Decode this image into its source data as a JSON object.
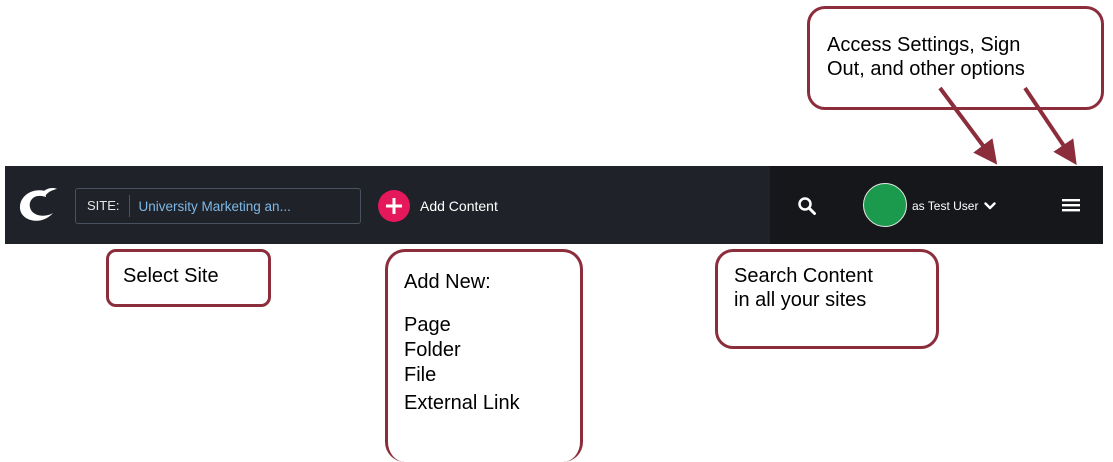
{
  "toolbar": {
    "site_label": "SITE:",
    "site_name": "University Marketing an...",
    "add_content_label": "Add Content",
    "user_label": "as Test User"
  },
  "callouts": {
    "settings": {
      "line1": "Access Settings, Sign",
      "line2": "Out, and other options"
    },
    "select_site": "Select Site",
    "add_new": {
      "title": "Add New:",
      "items": [
        "Page",
        "Folder",
        "File",
        "External Link"
      ]
    },
    "search": {
      "line1": "Search Content",
      "line2": "in all your sites"
    }
  },
  "colors": {
    "navbar": "#1f2228",
    "navbar_right": "#15171b",
    "add_button": "#e5185c",
    "avatar": "#1b9a4e",
    "site_name_text": "#7fb8e6",
    "callout_border": "#8c2d3b"
  },
  "icons": [
    "logo-icon",
    "plus-icon",
    "search-icon",
    "chevron-down-icon",
    "hamburger-menu-icon"
  ]
}
